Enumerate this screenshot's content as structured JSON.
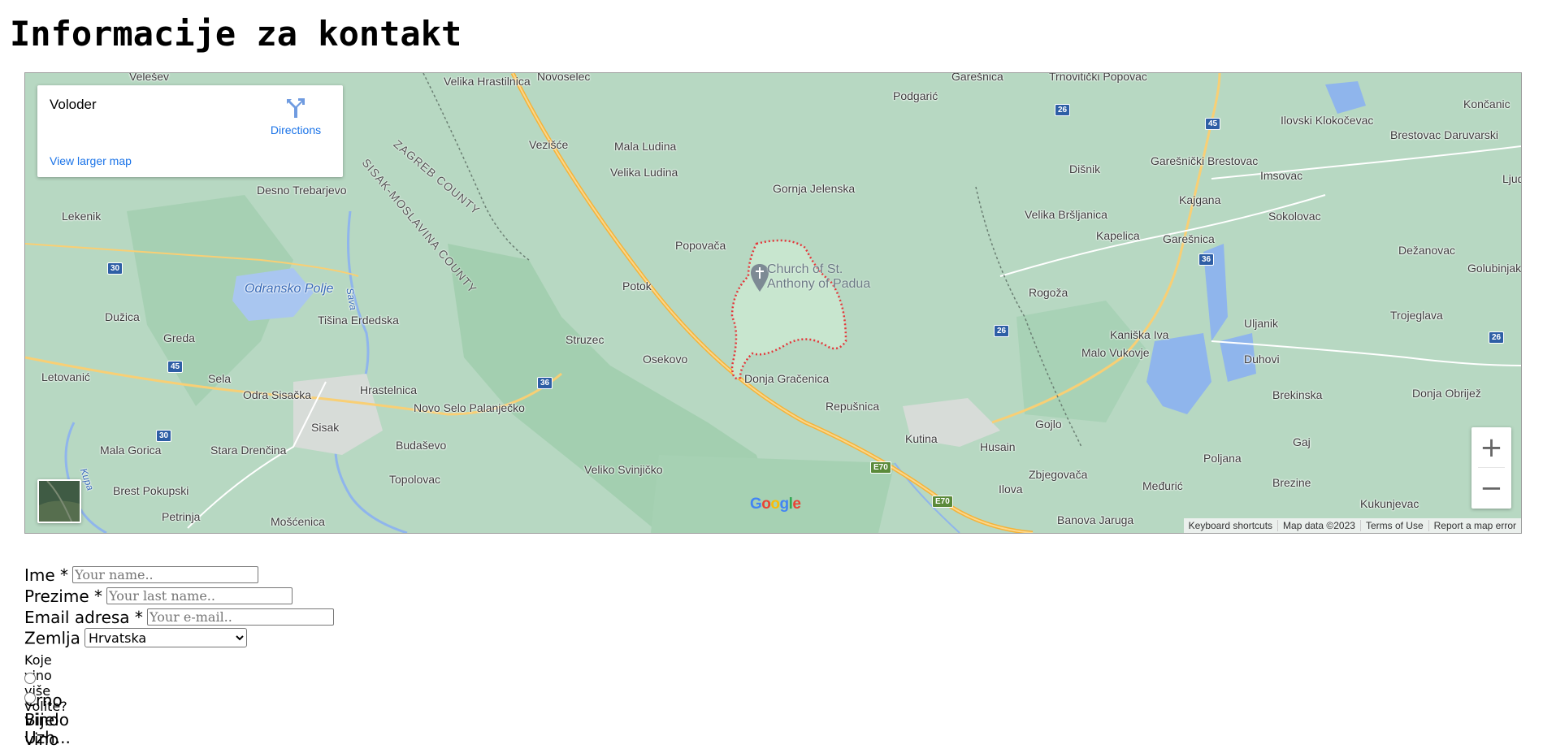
{
  "heading": "Informacije za kontakt",
  "map": {
    "info_title": "Voloder",
    "directions_label": "Directions",
    "view_larger": "View larger map",
    "poi_name": "Church of St. Anthony of Padua",
    "google_logo": "Google",
    "footer": [
      "Keyboard shortcuts",
      "Map data ©2023",
      "Terms of Use",
      "Report a map error"
    ],
    "zoom_in": "+",
    "zoom_out": "−",
    "places": [
      "Velešev",
      "Velika Hrastilnica",
      "Novoselec",
      "Garešnica",
      "Trnovitički Popovac",
      "Podgarić",
      "Končanic",
      "Vezišće",
      "Mala Ludina",
      "Velika Ludina",
      "Ilovski Klokočevac",
      "Brestovac Daruvarski",
      "Dišnik",
      "Garešnički Brestovac",
      "Imsovac",
      "Kajgana",
      "Sokolovac",
      "Ljud",
      "Gornja Jelenska",
      "Desno Trebarjevo",
      "Lekenik",
      "Popovača",
      "Velika Bršljanica",
      "Kapelica",
      "Garešnica",
      "Dežanovac",
      "Golubinjak",
      "Odransko Polje",
      "Potok",
      "Rogoža",
      "Dužica",
      "Tišina Erdedska",
      "Greda",
      "Struzec",
      "Kaniška Iva",
      "Uljanik",
      "Trojeglava",
      "Malo Vukovje",
      "Letovanić",
      "Sela",
      "Osekovo",
      "Duhovi",
      "Donja Gračenica",
      "Odra Sisačka",
      "Hrastelnica",
      "Novo Selo Palanječko",
      "Repušnica",
      "Brekinska",
      "Donja Obrijež",
      "Sisak",
      "Kutina",
      "Gojlo",
      "Mala Gorica",
      "Stara Drenčina",
      "Budaševo",
      "Husain",
      "Poljana",
      "Gaj",
      "Brest Pokupski",
      "Topolovac",
      "Veliko Svinjičko",
      "Zbjegovača",
      "Ilova",
      "Međurić",
      "Brezine",
      "Petrinja",
      "Mošćenica",
      "Banova Jaruga",
      "Kukunjevac"
    ],
    "counties": [
      "ZAGREB COUNTY",
      "SISAK-MOSLAVINA COUNTY"
    ],
    "rivers": [
      "Sava",
      "Kupa"
    ],
    "road_shields": [
      "26",
      "45",
      "30",
      "36",
      "26",
      "45",
      "36",
      "30",
      "E70",
      "E70",
      "26"
    ]
  },
  "form": {
    "first_name_label": "Ime *",
    "first_name_placeholder": "Your name..",
    "last_name_label": "Prezime *",
    "last_name_placeholder": "Your last name..",
    "email_label": "Email adresa *",
    "email_placeholder": "Your e-mail..",
    "country_label": "Zemlja",
    "country_selected": "Hrvatska",
    "wine_question": "Koje vino više volite?",
    "wine_options": [
      "Crno vino",
      "Bijelo vino"
    ],
    "cut_text": "Uzh..."
  },
  "colors": {
    "map_bg": "#b7d8c2",
    "link": "#1a73e8",
    "road_major": "#f4b33a",
    "boundary": "#e4373a"
  }
}
